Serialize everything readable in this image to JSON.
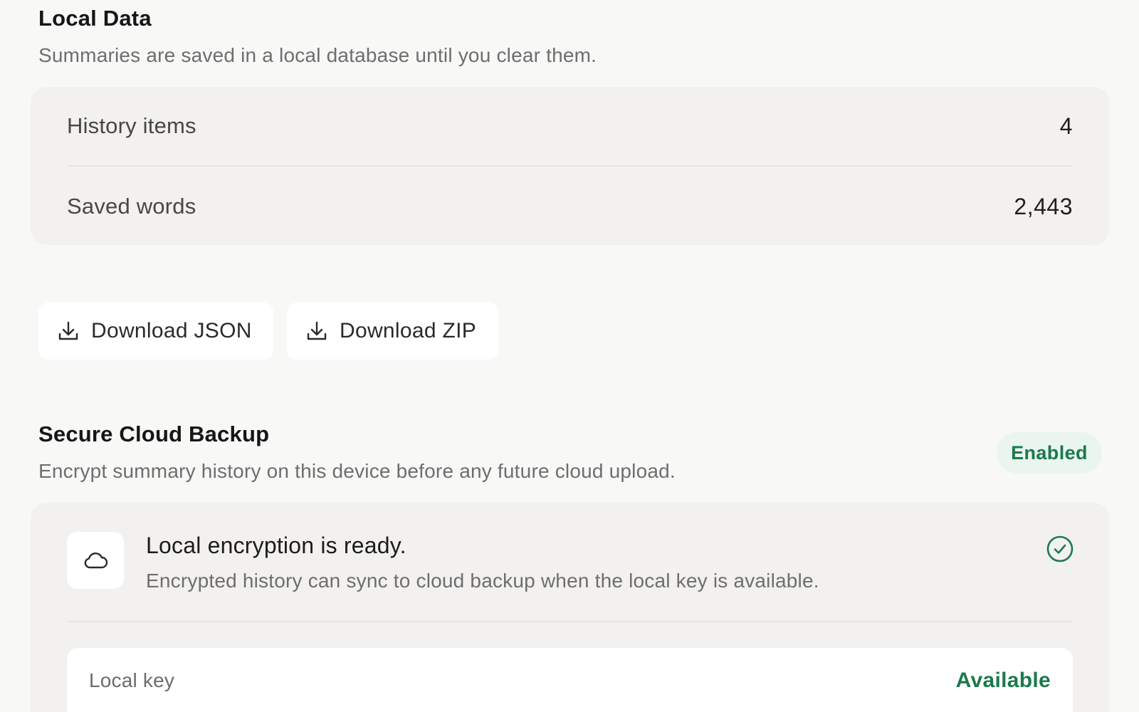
{
  "local_data": {
    "title": "Local Data",
    "description": "Summaries are saved in a local database until you clear them.",
    "stats": [
      {
        "label": "History items",
        "value": "4"
      },
      {
        "label": "Saved words",
        "value": "2,443"
      }
    ],
    "buttons": {
      "download_json": {
        "label": "Download JSON",
        "icon": "download-icon"
      },
      "download_zip": {
        "label": "Download ZIP",
        "icon": "download-icon"
      }
    }
  },
  "cloud_backup": {
    "title": "Secure Cloud Backup",
    "description": "Encrypt summary history on this device before any future cloud upload.",
    "badge": "Enabled",
    "status": {
      "icon": "cloud-icon",
      "title": "Local encryption is ready.",
      "description": "Encrypted history can sync to cloud backup when the local key is available.",
      "check_icon": "check-circle-icon"
    },
    "key": {
      "label": "Local key",
      "status": "Available"
    }
  },
  "colors": {
    "background": "#f8f8f7",
    "card": "#f2f1ef",
    "accent_green": "#1b7a4c",
    "badge_bg": "#eaf5ef"
  }
}
